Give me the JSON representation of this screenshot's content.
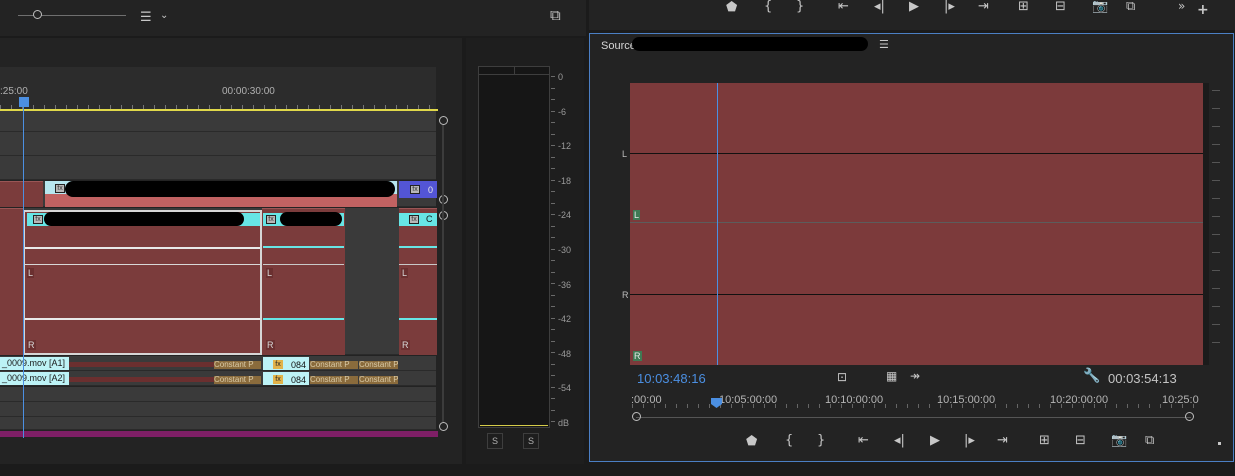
{
  "timeline": {
    "ruler_labels": [
      ":25:00",
      "00:00:30:00"
    ],
    "track_markers": {
      "left": "L",
      "right": "R"
    },
    "clip_badges": [
      "0",
      "C",
      "084",
      "084"
    ],
    "clip_names": [
      "_0009.mov [A1]",
      "_0009.mov [A2]"
    ],
    "constant_label": "Constant P"
  },
  "meter": {
    "scale": [
      "0",
      "-6",
      "-12",
      "-18",
      "-24",
      "-30",
      "-36",
      "-42",
      "-48",
      "-54",
      "dB"
    ],
    "solo_labels": [
      "S",
      "S"
    ]
  },
  "source": {
    "tab_label": "Source",
    "channel_labels": {
      "left": "L",
      "right": "R"
    },
    "current_timecode": "10:03:48:16",
    "duration_timecode": "00:03:54:13",
    "ruler_labels": [
      ":00:00",
      "10:05:00:00",
      "10:10:00:00",
      "10:15:00:00",
      "10:20:00:00",
      "10:25:0"
    ]
  },
  "colors": {
    "accent_blue": "#4b8fe2",
    "waveform_red": "#7c3a3b",
    "clip_cyan": "#67e5e5",
    "track_purple": "#7e1f66"
  }
}
